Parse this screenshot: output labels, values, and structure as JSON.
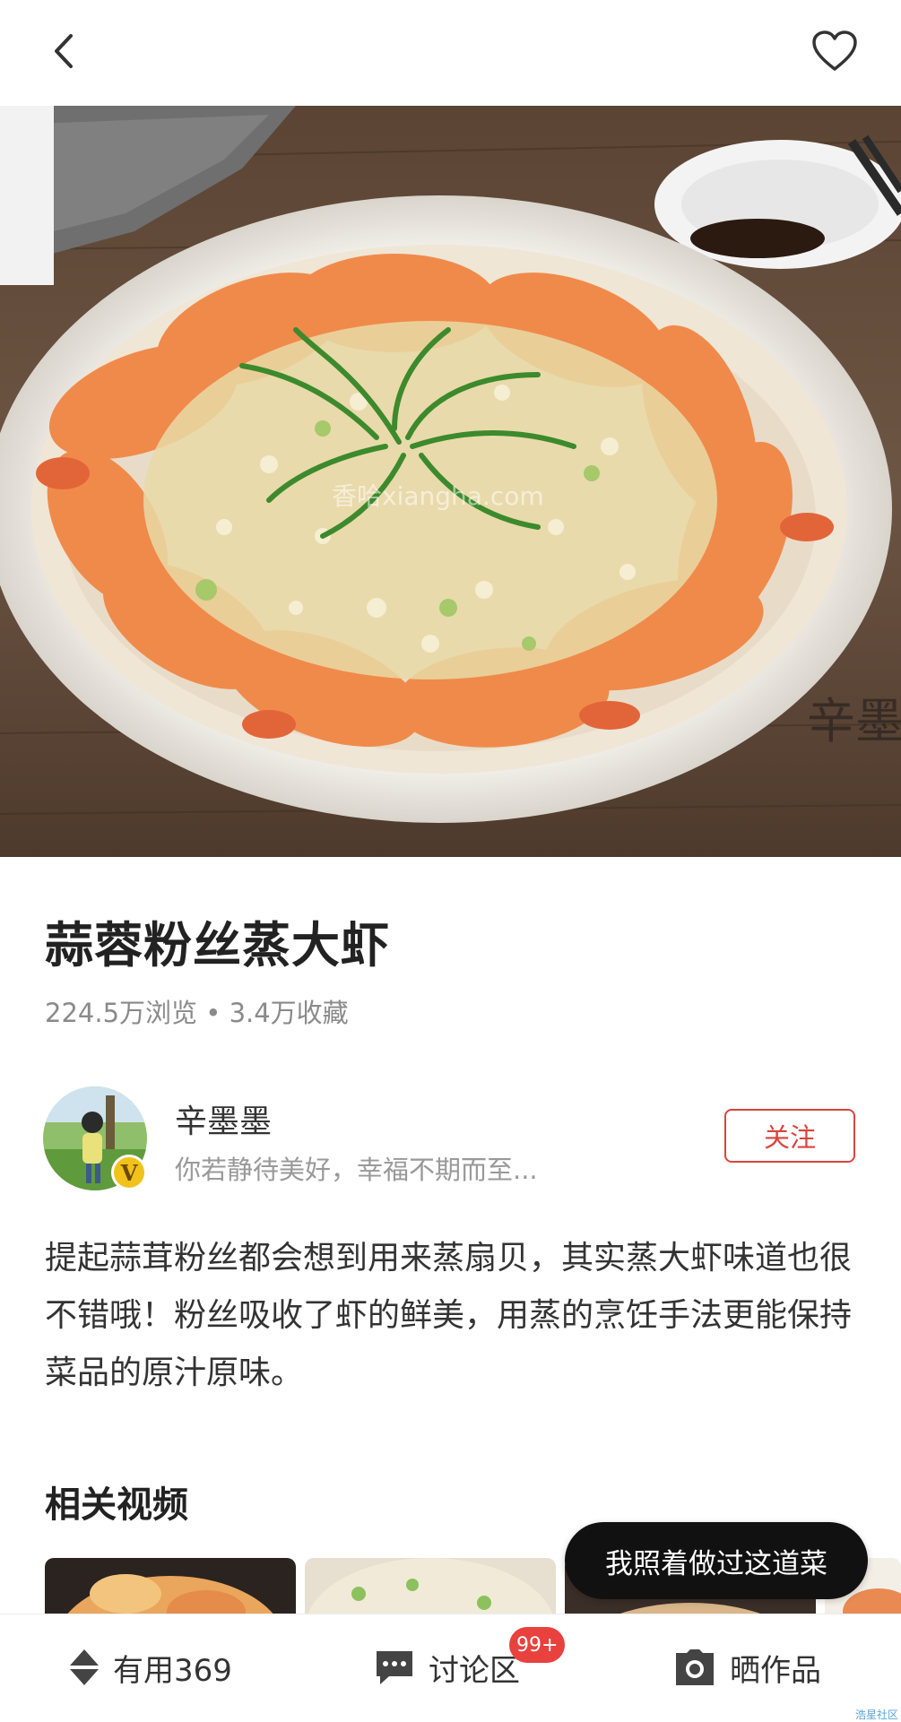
{
  "header": {
    "back_icon": "chevron-left-icon",
    "favorite_icon": "heart-outline-icon"
  },
  "hero": {
    "image_description_icon": "steamed-shrimp-photo",
    "watermark_text": "香哈xiangha.com",
    "signature_text": "辛墨"
  },
  "recipe": {
    "title": "蒜蓉粉丝蒸大虾",
    "meta": "224.5万浏览 • 3.4万收藏",
    "description": "提起蒜茸粉丝都会想到用来蒸扇贝，其实蒸大虾味道也很不错哦！粉丝吸收了虾的鲜美，用蒸的烹饪手法更能保持菜品的原汁原味。"
  },
  "author": {
    "name": "辛墨墨",
    "bio": "你若静待美好，幸福不期而至...",
    "verified_badge": "V",
    "follow_label": "关注"
  },
  "related": {
    "title": "相关视频"
  },
  "floating": {
    "cooked_label": "我照着做过这道菜"
  },
  "bottom_bar": {
    "useful_label": "有用369",
    "discuss_label": "讨论区",
    "discuss_badge": "99+",
    "post_label": "晒作品"
  },
  "colors": {
    "accent": "#d9443f",
    "badge": "#e8413e",
    "pill": "#111111"
  },
  "watermark": "浩星社区"
}
